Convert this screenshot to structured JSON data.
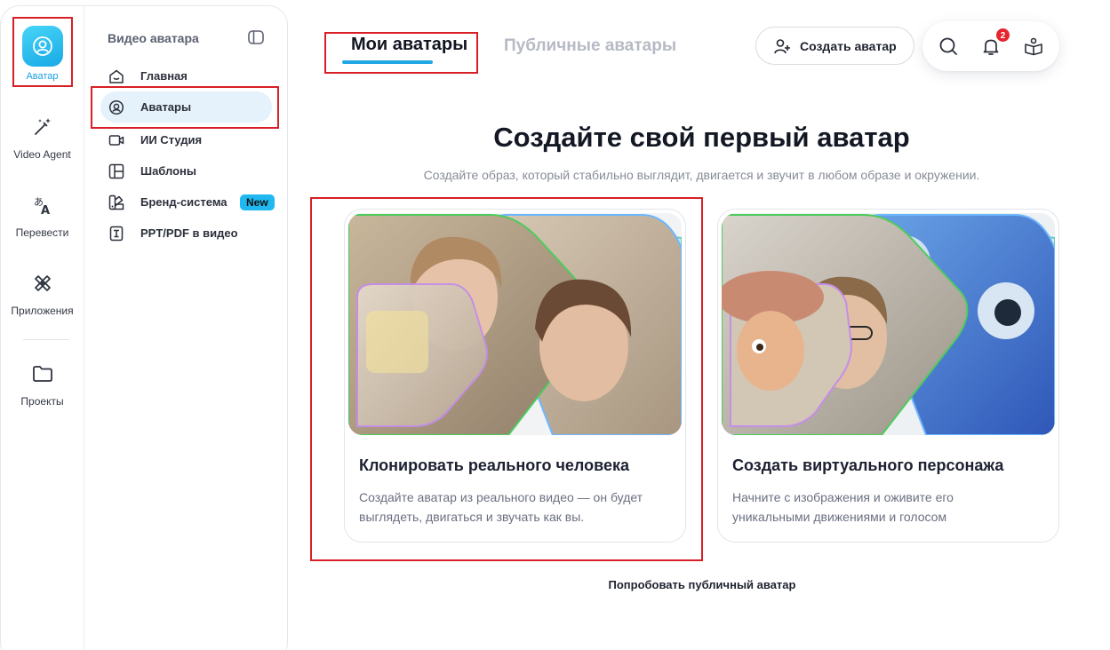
{
  "rail": {
    "items": [
      {
        "label": "Аватар",
        "icon": "avatar-icon",
        "active": true
      },
      {
        "label": "Video Agent",
        "icon": "magic-wand-icon"
      },
      {
        "label": "Перевести",
        "icon": "translate-icon"
      },
      {
        "label": "Приложения",
        "icon": "apps-icon"
      },
      {
        "label": "Проекты",
        "icon": "folder-icon"
      }
    ]
  },
  "subnav": {
    "title": "Видео аватара",
    "items": [
      {
        "label": "Главная",
        "icon": "home-icon"
      },
      {
        "label": "Аватары",
        "icon": "avatar-circle-icon",
        "active": true
      },
      {
        "label": "ИИ Студия",
        "icon": "video-camera-icon"
      },
      {
        "label": "Шаблоны",
        "icon": "template-icon"
      },
      {
        "label": "Бренд-система",
        "icon": "palette-icon",
        "badge": "New"
      },
      {
        "label": "PPT/PDF в видео",
        "icon": "document-icon"
      }
    ]
  },
  "header": {
    "tabs": [
      {
        "label": "Мои аватары",
        "active": true
      },
      {
        "label": "Публичные аватары"
      }
    ],
    "create_button": "Создать аватар",
    "notifications_count": "2",
    "tools": [
      "search-icon",
      "bell-icon",
      "learn-icon"
    ]
  },
  "hero": {
    "title": "Создайте свой первый аватар",
    "subtitle": "Создайте образ, который стабильно выглядит, двигается и звучит в любом образе и окружении."
  },
  "cards": [
    {
      "title": "Клонировать реального человека",
      "desc_lines": [
        "Создайте аватар из реального видео — он будет",
        "выглядеть, двигаться и звучать как вы."
      ]
    },
    {
      "title": "Создать виртуального персонажа",
      "desc_lines": [
        "Начните с изображения и оживите его",
        "уникальными движениями и голосом"
      ]
    }
  ],
  "footer_link": "Попробовать публичный аватар",
  "colors": {
    "accent": "#21a7e6",
    "highlight": "#d91f26",
    "badge_new": "#1fb8f0",
    "notification": "#e5262f"
  }
}
